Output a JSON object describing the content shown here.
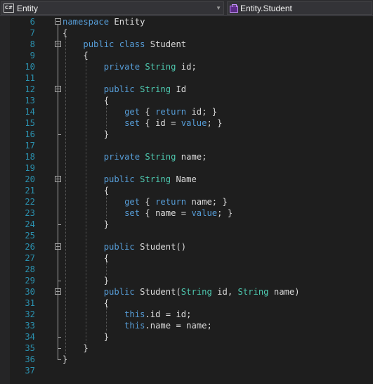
{
  "navbar": {
    "project_dropdown": "Entity",
    "language_badge": "C#",
    "type_dropdown": "Entity.Student"
  },
  "editor": {
    "lines": [
      {
        "number": "6",
        "code": "namespace Entity"
      },
      {
        "number": "7",
        "code": "{"
      },
      {
        "number": "8",
        "code": "    public class Student"
      },
      {
        "number": "9",
        "code": "    {"
      },
      {
        "number": "10",
        "code": "        private String id;"
      },
      {
        "number": "11",
        "code": ""
      },
      {
        "number": "12",
        "code": "        public String Id"
      },
      {
        "number": "13",
        "code": "        {"
      },
      {
        "number": "14",
        "code": "            get { return id; }"
      },
      {
        "number": "15",
        "code": "            set { id = value; }"
      },
      {
        "number": "16",
        "code": "        }"
      },
      {
        "number": "17",
        "code": ""
      },
      {
        "number": "18",
        "code": "        private String name;"
      },
      {
        "number": "19",
        "code": ""
      },
      {
        "number": "20",
        "code": "        public String Name"
      },
      {
        "number": "21",
        "code": "        {"
      },
      {
        "number": "22",
        "code": "            get { return name; }"
      },
      {
        "number": "23",
        "code": "            set { name = value; }"
      },
      {
        "number": "24",
        "code": "        }"
      },
      {
        "number": "25",
        "code": ""
      },
      {
        "number": "26",
        "code": "        public Student()"
      },
      {
        "number": "27",
        "code": "        {"
      },
      {
        "number": "28",
        "code": ""
      },
      {
        "number": "29",
        "code": "        }"
      },
      {
        "number": "30",
        "code": "        public Student(String id, String name)"
      },
      {
        "number": "31",
        "code": "        {"
      },
      {
        "number": "32",
        "code": "            this.id = id;"
      },
      {
        "number": "33",
        "code": "            this.name = name;"
      },
      {
        "number": "34",
        "code": "        }"
      },
      {
        "number": "35",
        "code": "    }"
      },
      {
        "number": "36",
        "code": "}"
      },
      {
        "number": "37",
        "code": ""
      }
    ]
  },
  "colors": {
    "background": "#1e1e1e",
    "line_number": "#2b91af",
    "keyword": "#569cd6",
    "type": "#4ec9b0",
    "text": "#dcdcdc"
  }
}
